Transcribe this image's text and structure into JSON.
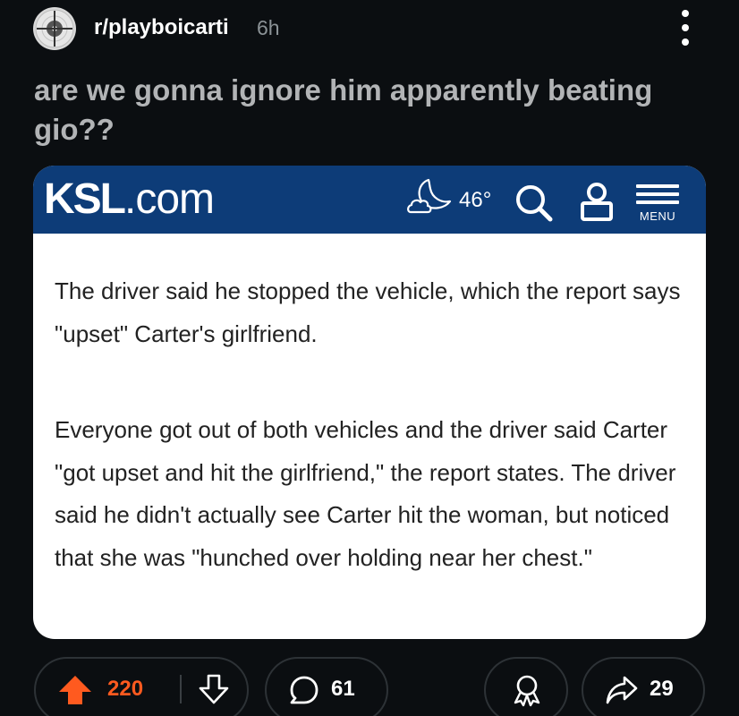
{
  "post": {
    "subreddit": "r/playboicarti",
    "age": "6h",
    "title": "are we gonna ignore him apparently beating gio??"
  },
  "article": {
    "site_logo_bold": "KSL",
    "site_logo_rest": ".com",
    "temperature": "46°",
    "menu_label": "MENU",
    "weather_icon": "moon-cloud-icon",
    "paragraphs": [
      "The driver said he stopped the vehicle, which the report says \"upset\" Carter's girlfriend.",
      "Everyone got out of both vehicles and the driver said Carter \"got upset and hit the girlfriend,\" the report states. The driver said he didn't actually see Carter hit the woman, but noticed that she was \"hunched over holding near her chest.\""
    ],
    "header_color": "#0d3c78"
  },
  "actions": {
    "upvotes": "220",
    "comments": "61",
    "shares": "29",
    "upvote_color": "#ff5a1f"
  }
}
